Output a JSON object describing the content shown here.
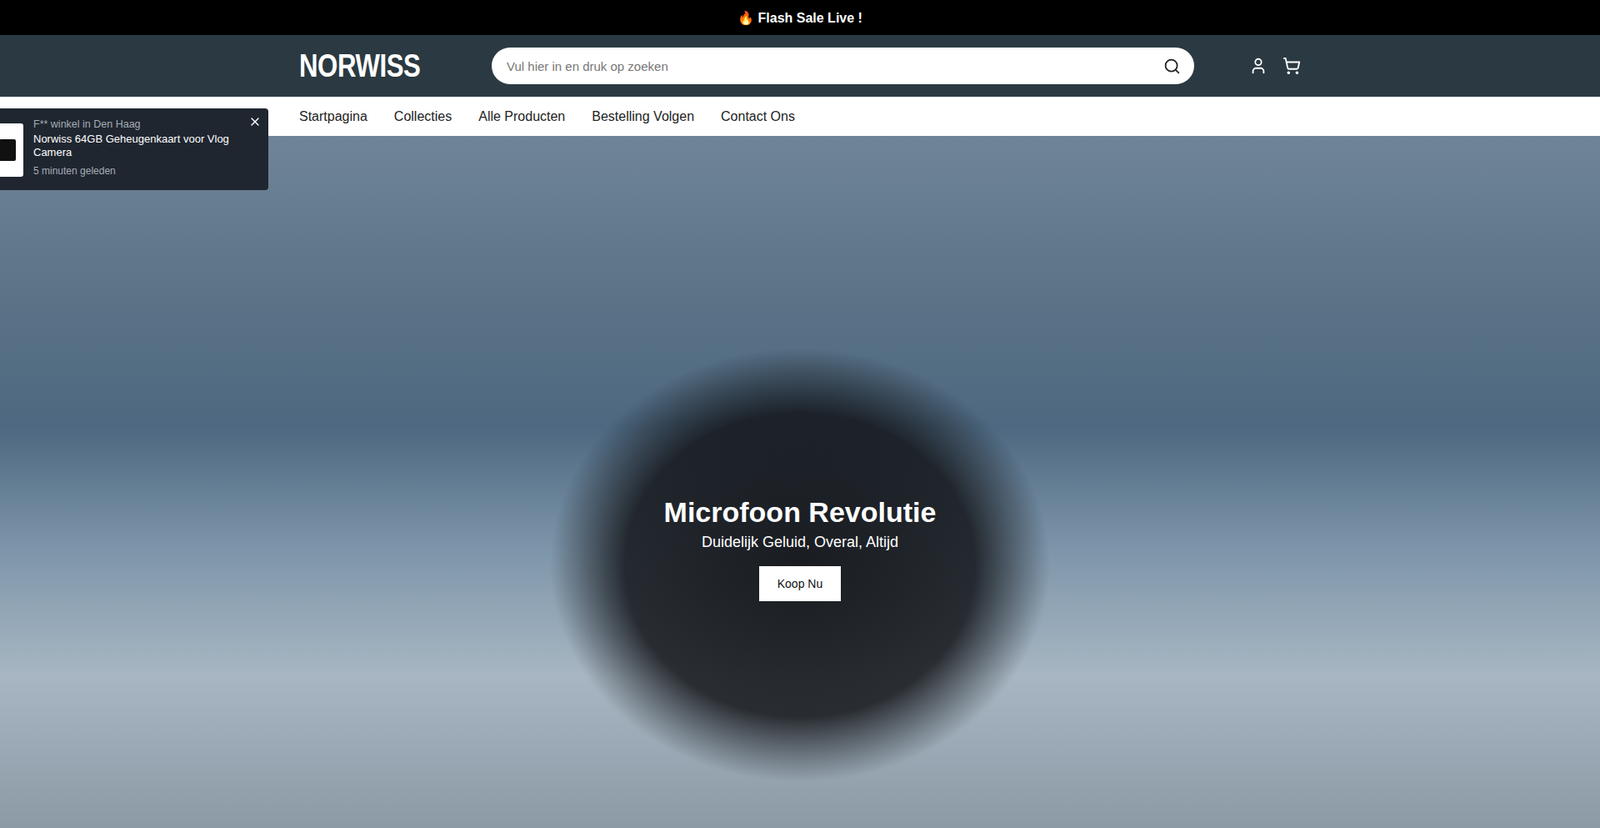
{
  "announcement": "🔥 Flash Sale Live !",
  "header": {
    "logo": "NORWISS",
    "search": {
      "placeholder": "Vul hier in en druk op zoeken"
    }
  },
  "nav": [
    "Startpagina",
    "Collecties",
    "Alle Producten",
    "Bestelling Volgen",
    "Contact Ons"
  ],
  "hero": {
    "title": "Microfoon Revolutie",
    "subtitle": "Duidelijk Geluid, Overal, Altijd",
    "button": "Koop Nu"
  },
  "notification": {
    "location": "F** winkel in Den Haag",
    "product": "Norwiss 64GB Geheugenkaart voor Vlog Camera",
    "time": "5 minuten geleden"
  }
}
